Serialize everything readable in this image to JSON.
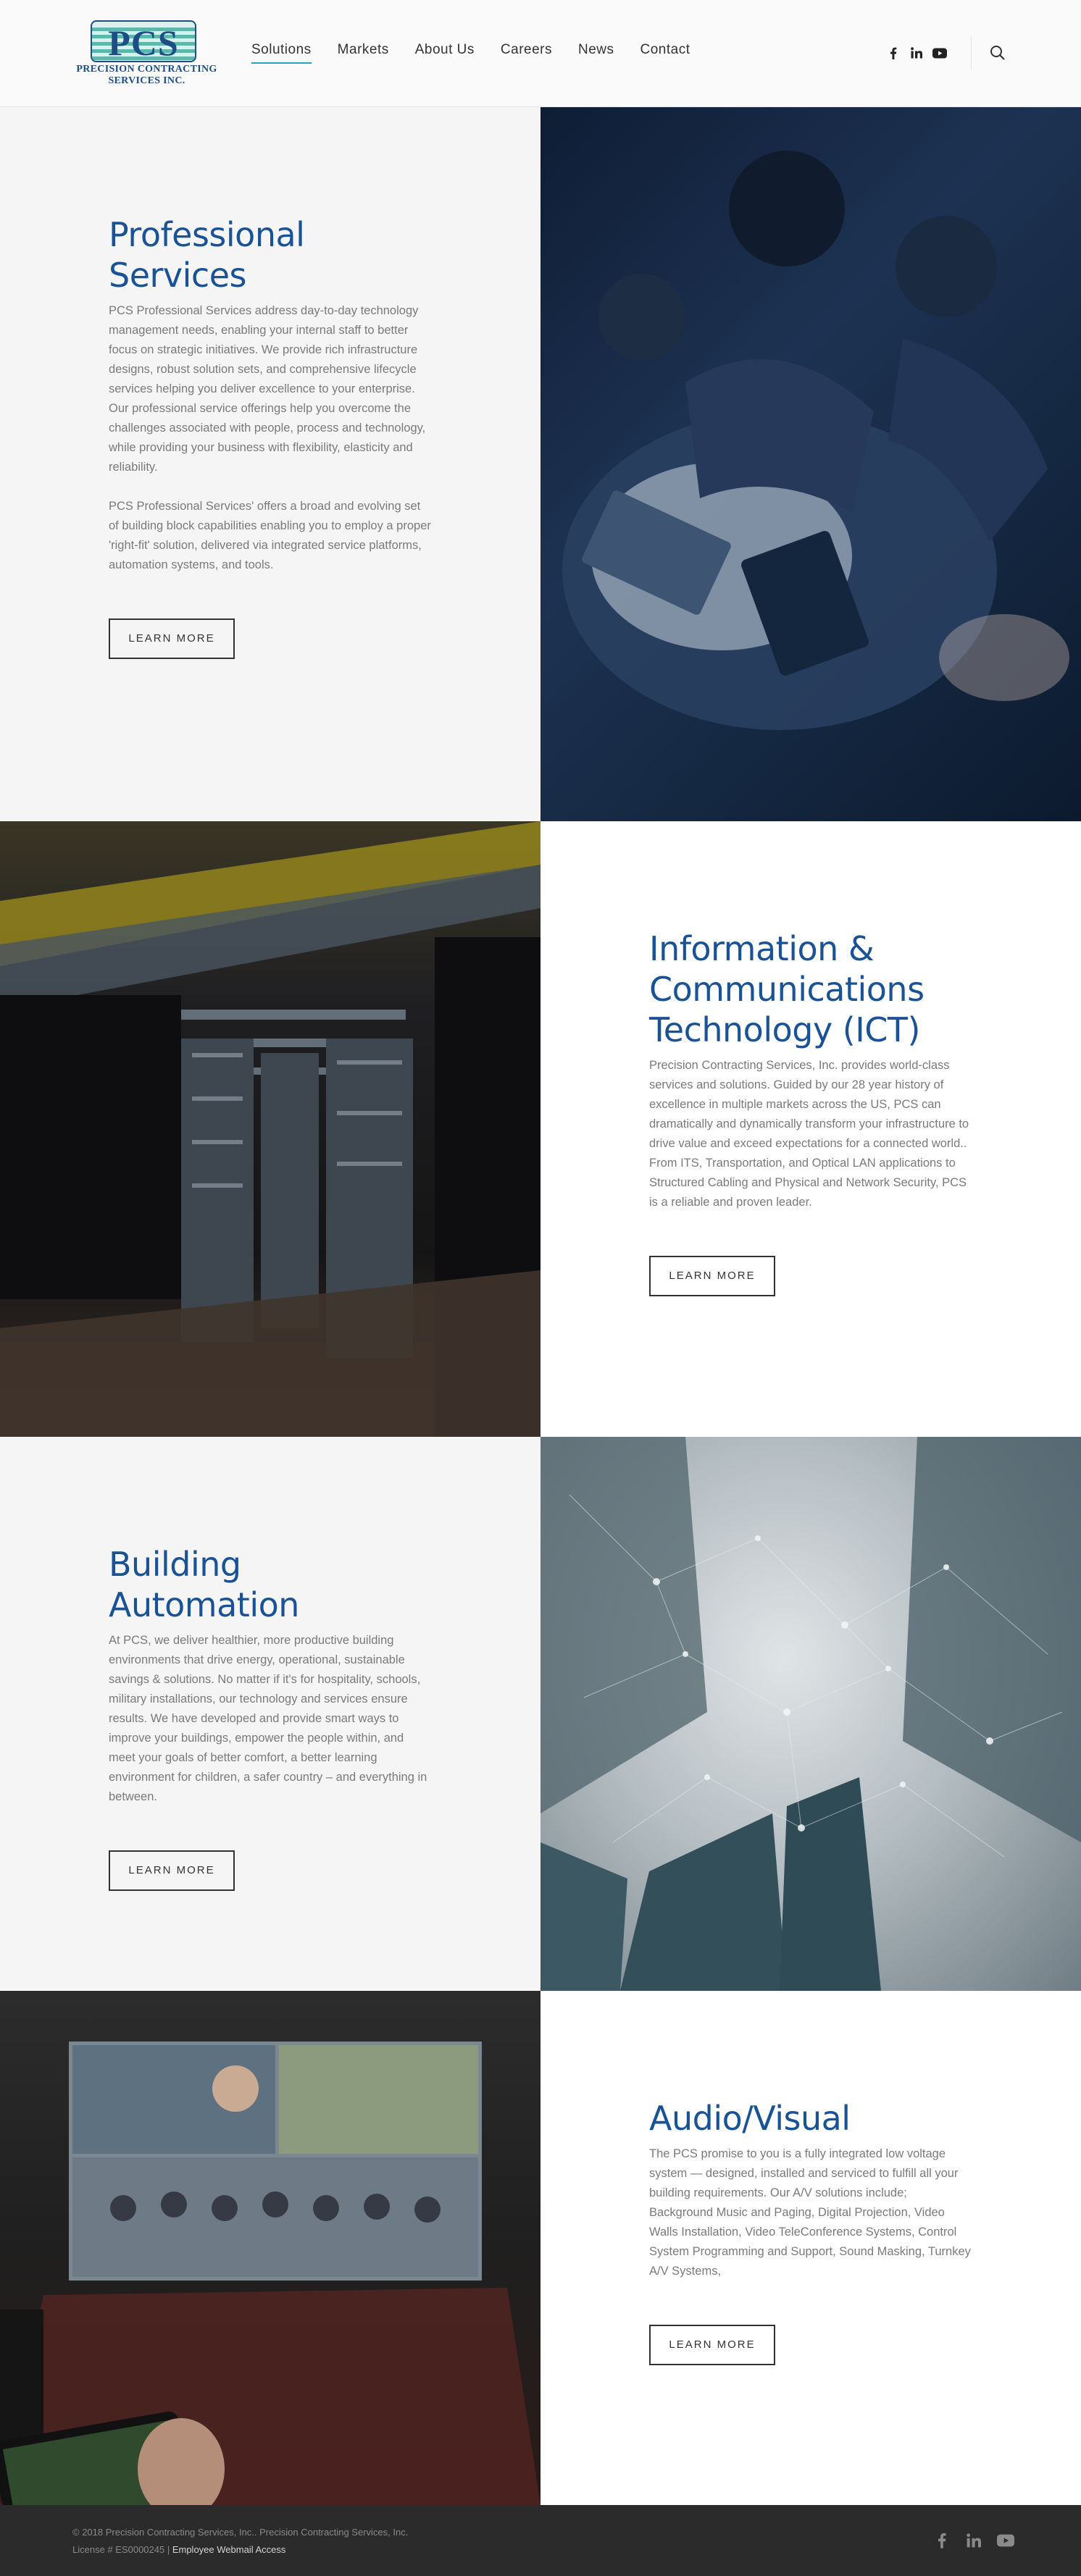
{
  "brand": {
    "logo_letters": "PCS",
    "logo_line1": "PRECISION CONTRACTING",
    "logo_line2": "SERVICES INC.",
    "primary_color": "#1a5296",
    "accent_color": "#2aa1c4"
  },
  "nav": {
    "items": [
      {
        "label": "Solutions",
        "active": true
      },
      {
        "label": "Markets",
        "active": false
      },
      {
        "label": "About Us",
        "active": false
      },
      {
        "label": "Careers",
        "active": false
      },
      {
        "label": "News",
        "active": false
      },
      {
        "label": "Contact",
        "active": false
      }
    ],
    "social_icons": [
      "facebook-icon",
      "linkedin-icon",
      "youtube-icon"
    ],
    "search_icon": "search-icon"
  },
  "sections": [
    {
      "title_line1": "Professional",
      "title_line2": "Services",
      "paragraphs": [
        "PCS Professional Services address day-to-day technology management needs, enabling your internal staff to better focus on strategic initiatives. We provide rich infrastructure designs, robust solution sets, and comprehensive lifecycle services helping you deliver excellence to your enterprise. Our professional service offerings help you overcome the challenges associated with people, process and technology, while providing your business with flexibility, elasticity and reliability.",
        "PCS Professional Services' offers a broad and evolving set of building block capabilities enabling you to employ a proper 'right-fit' solution, delivered via integrated service platforms, automation systems, and tools."
      ],
      "button": "LEARN MORE"
    },
    {
      "title_line1": "Information &",
      "title_line2": "Communications",
      "title_line3": "Technology (ICT)",
      "paragraphs": [
        "Precision Contracting Services, Inc. provides world-class services and solutions. Guided by our 28 year history of excellence in multiple markets across the US, PCS can dramatically and dynamically transform your infrastructure to drive value and exceed expectations for a connected world.. From ITS, Transportation, and Optical LAN applications to Structured Cabling and Physical and Network Security, PCS is a reliable and proven leader."
      ],
      "button": "LEARN MORE"
    },
    {
      "title_line1": "Building Automation",
      "paragraphs": [
        "At PCS, we deliver healthier, more productive building environments that drive energy, operational, sustainable savings & solutions. No matter if it's for hospitality, schools, military installations, our technology and services ensure results. We have developed and provide smart ways to improve your buildings, empower the people within, and meet your goals of better comfort, a better learning environment for children, a safer country – and everything in between."
      ],
      "button": "LEARN MORE"
    },
    {
      "title_line1": "Audio/Visual",
      "paragraphs": [
        "The PCS promise to you is a fully integrated low voltage system — designed, installed and serviced to fulfill all your building requirements. Our A/V solutions include; Background Music and Paging, Digital Projection, Video Walls Installation, Video TeleConference Systems, Control System Programming and Support, Sound Masking, Turnkey A/V Systems,"
      ],
      "button": "LEARN MORE"
    }
  ],
  "footer": {
    "copyright": "© 2018 Precision Contracting Services, Inc.. Precision Contracting Services, Inc.",
    "license": "License # ES0000245",
    "separator": " | ",
    "webmail_link": "Employee Webmail Access",
    "social_icons": [
      "facebook-icon",
      "linkedin-icon",
      "youtube-icon"
    ]
  }
}
